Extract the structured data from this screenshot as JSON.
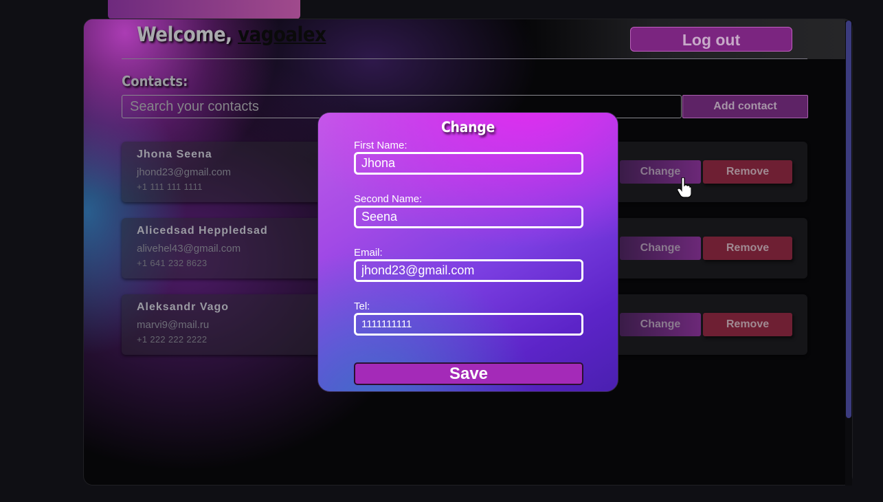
{
  "header": {
    "welcome_prefix": "Welcome,",
    "username": "vagoalex",
    "logout_label": "Log out"
  },
  "contacts": {
    "label": "Contacts:",
    "search_placeholder": "Search your contacts",
    "add_label": "Add contact",
    "change_label": "Change",
    "remove_label": "Remove",
    "items": [
      {
        "name": "Jhona Seena",
        "email": "jhond23@gmail.com",
        "phone": "+1 111 111 1111"
      },
      {
        "name": "Alicedsad Heppledsad",
        "email": "alivehel43@gmail.com",
        "phone": "+1 641 232 8623"
      },
      {
        "name": "Aleksandr Vago",
        "email": "marvi9@mail.ru",
        "phone": "+1 222 222 2222"
      }
    ]
  },
  "modal": {
    "title": "Change",
    "first_name_label": "First Name:",
    "first_name_value": "Jhona",
    "second_name_label": "Second Name:",
    "second_name_value": "Seena",
    "email_label": "Email:",
    "email_value": "jhond23@gmail.com",
    "tel_label": "Tel:",
    "tel_value": "1111111111",
    "save_label": "Save"
  },
  "colors": {
    "accent": "#7b2580",
    "remove": "#6e1f33",
    "modal_top": "#e02cf0",
    "modal_bottom": "#4a20b0"
  },
  "icons": [
    "hand-pointer-icon"
  ]
}
